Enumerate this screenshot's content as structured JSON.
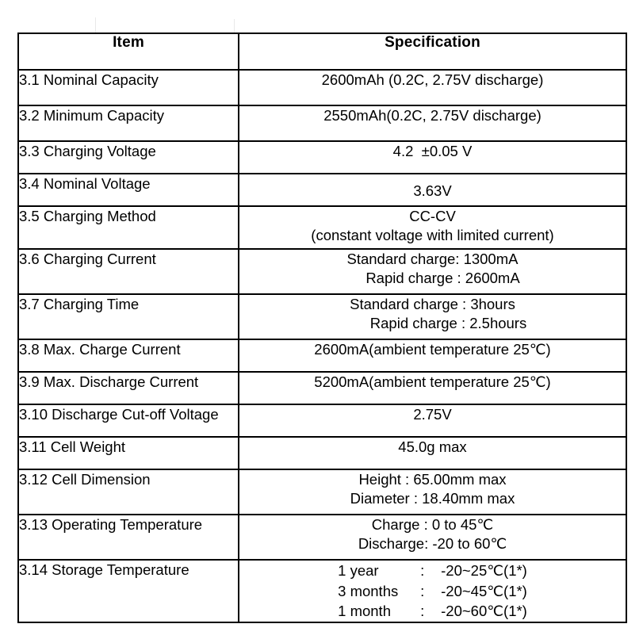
{
  "table": {
    "headers": {
      "item": "Item",
      "specification": "Specification"
    },
    "rows": [
      {
        "item": "3.1 Nominal Capacity",
        "lines": [
          "2600mAh (0.2C, 2.75V discharge)"
        ]
      },
      {
        "item": "3.2 Minimum Capacity",
        "lines": [
          "2550mAh(0.2C, 2.75V discharge)"
        ]
      },
      {
        "item": "3.3 Charging Voltage",
        "lines": [
          "4.2  ±0.05 V"
        ]
      },
      {
        "item": "3.4 Nominal Voltage",
        "lines": [
          "3.63V"
        ]
      },
      {
        "item": "3.5 Charging Method",
        "lines": [
          "CC-CV",
          "(constant voltage with limited current)"
        ]
      },
      {
        "item": "3.6 Charging Current",
        "lines": [
          "Standard charge: 1300mA",
          "Rapid charge : 2600mA"
        ]
      },
      {
        "item": "3.7 Charging Time",
        "lines": [
          "Standard charge : 3hours",
          "Rapid charge : 2.5hours"
        ]
      },
      {
        "item": "3.8 Max. Charge Current",
        "lines": [
          "2600mA(ambient temperature 25℃)"
        ]
      },
      {
        "item": "3.9 Max. Discharge Current",
        "lines": [
          "5200mA(ambient temperature 25℃)"
        ]
      },
      {
        "item": "3.10 Discharge Cut-off Voltage",
        "lines": [
          "2.75V"
        ]
      },
      {
        "item": "3.11 Cell Weight",
        "lines": [
          "45.0g max"
        ]
      },
      {
        "item": "3.12 Cell Dimension",
        "lines": [
          "Height : 65.00mm max",
          "Diameter : 18.40mm max"
        ]
      },
      {
        "item": "3.13 Operating Temperature",
        "lines": [
          "Charge : 0 to 45℃",
          "Discharge: -20 to 60℃"
        ]
      },
      {
        "item": "3.14 Storage Temperature",
        "storage": [
          {
            "period": "1 year",
            "colon": ":",
            "value": "-20~25℃(1*)"
          },
          {
            "period": "3 months",
            "colon": ":",
            "value": "-20~45℃(1*)"
          },
          {
            "period": "1 month",
            "colon": ":",
            "value": "-20~60℃(1*)"
          }
        ]
      }
    ]
  },
  "style": {
    "border_color": "#000000",
    "text_color": "#000000",
    "background": "#ffffff"
  }
}
